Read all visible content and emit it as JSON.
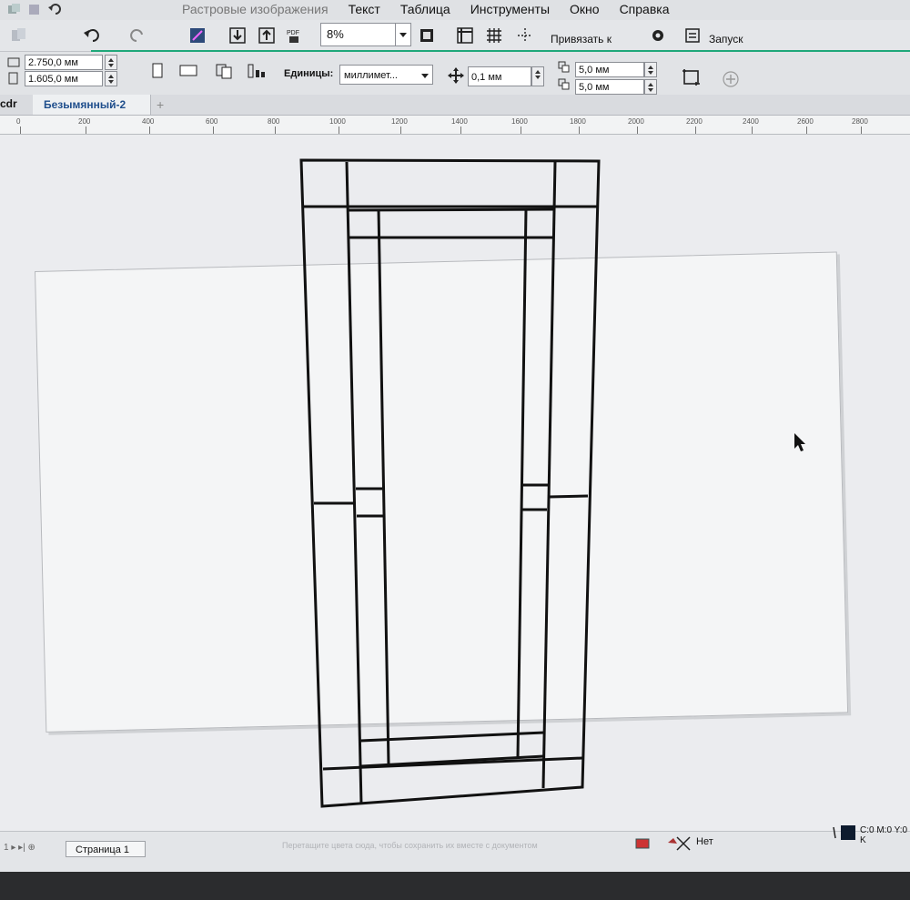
{
  "menu": {
    "items": [
      "Растровые изображения",
      "Текст",
      "Таблица",
      "Инструменты",
      "Окно",
      "Справка"
    ]
  },
  "toolbar": {
    "zoom": "8%",
    "snap_label": "Привязать к",
    "launch_label": "Запуск"
  },
  "property_bar": {
    "width": "2.750,0 мм",
    "height": "1.605,0 мм",
    "units_label": "Единицы:",
    "units_value": "миллимет...",
    "nudge": "0,1 мм",
    "dup_x": "5,0 мм",
    "dup_y": "5,0 мм"
  },
  "tabs": {
    "app": "cdr",
    "document": "Безымянный-2"
  },
  "ruler": {
    "labels": [
      "0",
      "200",
      "400",
      "600",
      "800",
      "1000",
      "1200",
      "1400",
      "1600",
      "1800",
      "2000",
      "2200",
      "2400",
      "2600",
      "2800"
    ]
  },
  "status": {
    "page_tab": "Страница 1",
    "hint": "Перетащите цвета сюда, чтобы сохранить их вместе с документом",
    "fill_none": "Нет",
    "color_readout": "C:0 M:0 Y:0 K"
  },
  "colors": {
    "accent_line": "#1fa87a",
    "drawing_stroke": "#111111"
  }
}
